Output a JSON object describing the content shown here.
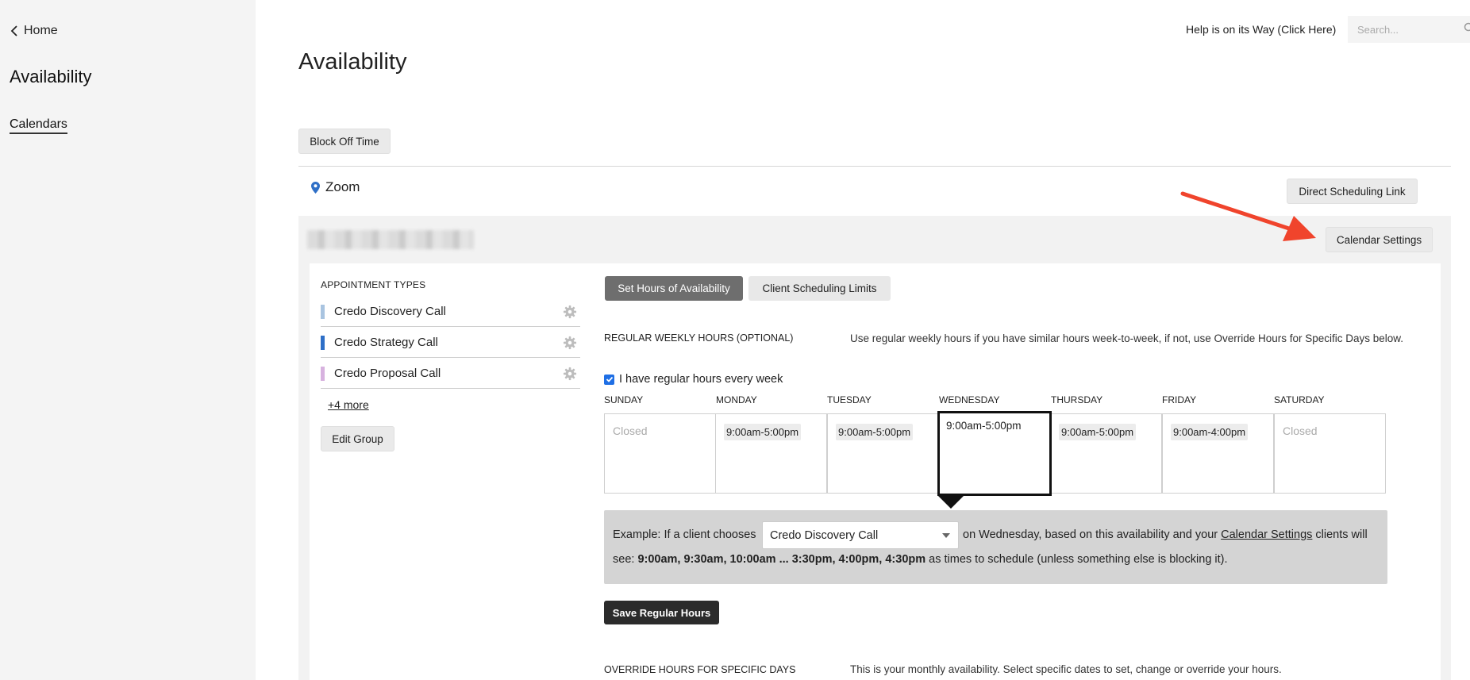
{
  "sidebar": {
    "back_label": "Home",
    "title": "Availability",
    "nav_calendars": "Calendars"
  },
  "topbar": {
    "help_link": "Help is on its Way (Click Here)",
    "search_placeholder": "Search..."
  },
  "page": {
    "title": "Availability",
    "block_off_time": "Block Off Time"
  },
  "calendar": {
    "location": "Zoom",
    "direct_link": "Direct Scheduling Link",
    "settings_button": "Calendar Settings"
  },
  "appointment_types": {
    "heading": "APPOINTMENT TYPES",
    "items": [
      {
        "label": "Credo Discovery Call",
        "color": "#a9c4e0"
      },
      {
        "label": "Credo Strategy Call",
        "color": "#2e6fc7"
      },
      {
        "label": "Credo Proposal Call",
        "color": "#d7b2df"
      }
    ],
    "more_link": "+4 more",
    "edit_group": "Edit Group"
  },
  "tabs": {
    "active": "Set Hours of Availability",
    "inactive": "Client Scheduling Limits"
  },
  "weekly": {
    "label": "REGULAR WEEKLY HOURS (OPTIONAL)",
    "description": "Use regular weekly hours if you have similar hours week-to-week, if not, use Override Hours for Specific Days below.",
    "checkbox_label": "I have regular hours every week",
    "days": [
      {
        "name": "SUNDAY",
        "hours": "",
        "closed": "Closed"
      },
      {
        "name": "MONDAY",
        "hours": "9:00am-5:00pm",
        "closed": ""
      },
      {
        "name": "TUESDAY",
        "hours": "9:00am-5:00pm",
        "closed": ""
      },
      {
        "name": "WEDNESDAY",
        "hours": "9:00am-5:00pm",
        "closed": ""
      },
      {
        "name": "THURSDAY",
        "hours": "9:00am-5:00pm",
        "closed": ""
      },
      {
        "name": "FRIDAY",
        "hours": "9:00am-4:00pm",
        "closed": ""
      },
      {
        "name": "SATURDAY",
        "hours": "",
        "closed": "Closed"
      }
    ]
  },
  "example": {
    "prefix": "Example: If a client chooses",
    "selected_type": "Credo Discovery Call",
    "middle": "on Wednesday, based on this availability and your",
    "link": "Calendar Settings",
    "suffix": "clients will",
    "see_prefix": "see:",
    "times": "9:00am, 9:30am, 10:00am ... 3:30pm, 4:00pm, 4:30pm",
    "see_suffix": "as times to schedule (unless something else is blocking it)."
  },
  "save_button": "Save Regular Hours",
  "override": {
    "label": "OVERRIDE HOURS FOR SPECIFIC DAYS",
    "description": "This is your monthly availability. Select specific dates to set, change or override your hours."
  },
  "colors": {
    "accent_blue": "#1f6fe5",
    "annotation_red": "#f0442c"
  }
}
